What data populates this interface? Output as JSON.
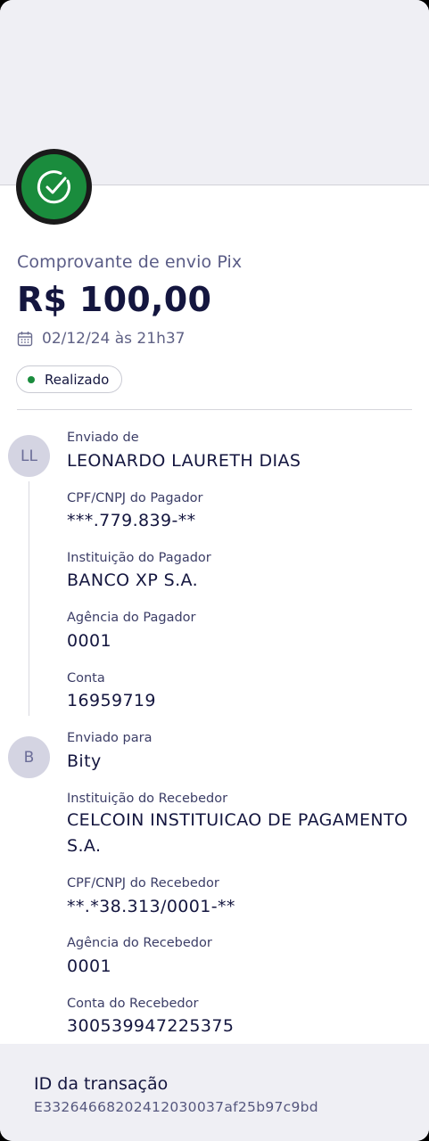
{
  "receipt": {
    "title": "Comprovante de envio Pix",
    "amount": "R$ 100,00",
    "datetime": "02/12/24 às 21h37",
    "status": "Realizado",
    "status_color": "#1a8c3d"
  },
  "sender": {
    "avatar_initials": "LL",
    "section_label": "Enviado de",
    "name": "LEONARDO LAURETH DIAS",
    "document_label": "CPF/CNPJ do Pagador",
    "document": "***.779.839-**",
    "institution_label": "Instituição do Pagador",
    "institution": "BANCO XP S.A.",
    "branch_label": "Agência do Pagador",
    "branch": "0001",
    "account_label": "Conta",
    "account": "16959719"
  },
  "receiver": {
    "avatar_initials": "B",
    "section_label": "Enviado para",
    "name": "Bity",
    "institution_label": "Instituição do Recebedor",
    "institution": "CELCOIN INSTITUICAO DE PAGAMENTO S.A.",
    "document_label": "CPF/CNPJ do Recebedor",
    "document": "**.*38.313/0001-**",
    "branch_label": "Agência do Recebedor",
    "branch": "0001",
    "account_label": "Conta do Recebedor",
    "account": "300539947225375"
  },
  "transaction": {
    "id_label": "ID da transação",
    "id": "E33264668202412030037af25b97c9bd"
  },
  "icons": {
    "success": "check-circle-icon",
    "calendar": "calendar-icon"
  }
}
